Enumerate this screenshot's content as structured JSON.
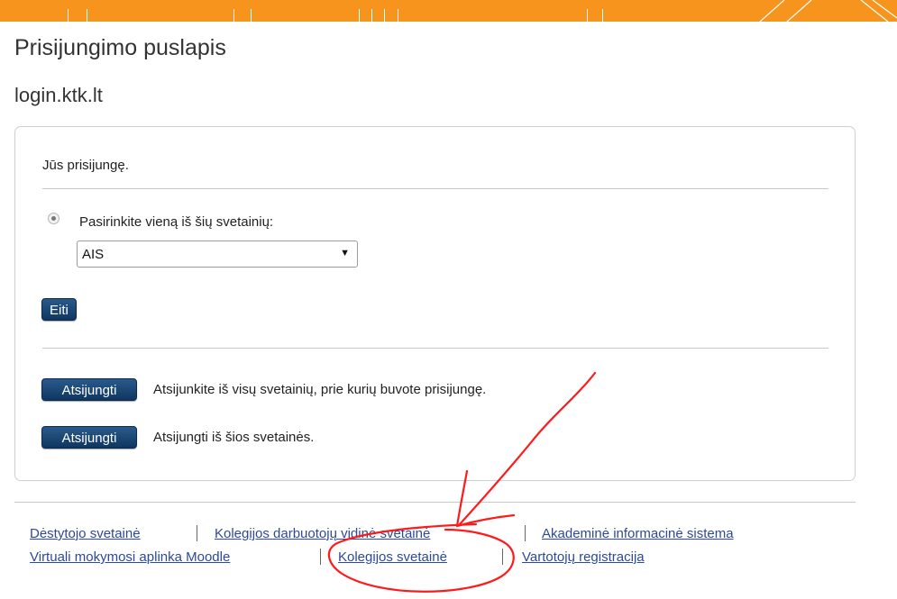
{
  "header": {
    "page_title": "Prisijungimo puslapis",
    "site_name": "login.ktk.lt",
    "banner_color": "#f7941d"
  },
  "panel": {
    "status": "Jūs prisijungę.",
    "radio_label": "Pasirinkite vieną iš šių svetainių:",
    "select_value": "AIS",
    "go_button": "Eiti",
    "logout_all_button": "Atsijungti",
    "logout_all_desc": "Atsijunkite iš visų svetainių, prie kurių buvote prisijungę.",
    "logout_this_button": "Atsijungti",
    "logout_this_desc": "Atsijungti iš šios svetainės."
  },
  "footer": {
    "links": [
      "Dėstytojo svetainė",
      "Kolegijos darbuotojų vidinė svetainė",
      "Akademinė informacinė sistema",
      "Virtuali mokymosi aplinka Moodle",
      "Kolegijos svetainė",
      "Vartotojų registracija"
    ]
  },
  "colors": {
    "button": "#1a4573",
    "link": "#2c4a9a",
    "annotation": "#ff0000"
  }
}
